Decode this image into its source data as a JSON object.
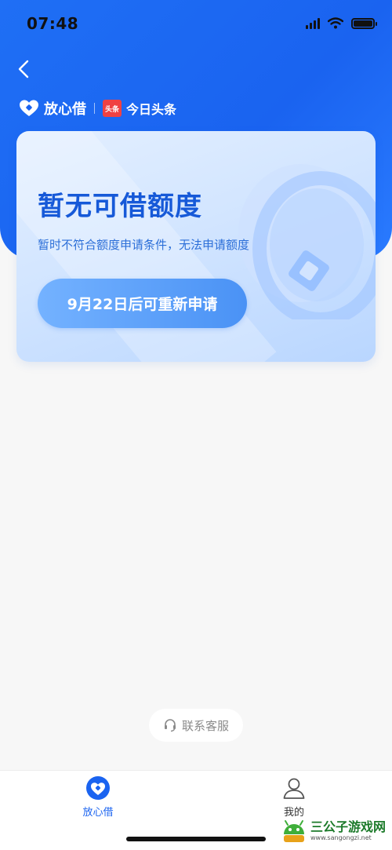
{
  "status_bar": {
    "time": "07:48"
  },
  "brand": {
    "name": "放心借",
    "partner_badge": "头条",
    "partner_name": "今日头条"
  },
  "card": {
    "title": "暂无可借额度",
    "subtitle": "暂时不符合额度申请条件，无法申请额度",
    "button_label": "9月22日后可重新申请"
  },
  "support": {
    "label": "联系客服",
    "icon": "headset-icon"
  },
  "tabs": [
    {
      "label": "放心借",
      "icon": "loan-logo-icon",
      "active": true
    },
    {
      "label": "我的",
      "icon": "user-icon",
      "active": false
    }
  ],
  "watermark": {
    "title": "三公子游戏网",
    "url": "www.sangongzi.net"
  },
  "colors": {
    "primary": "#1a63f0",
    "card_title": "#1659d8",
    "button": "#4a92f5",
    "partner_red": "#f04142"
  }
}
